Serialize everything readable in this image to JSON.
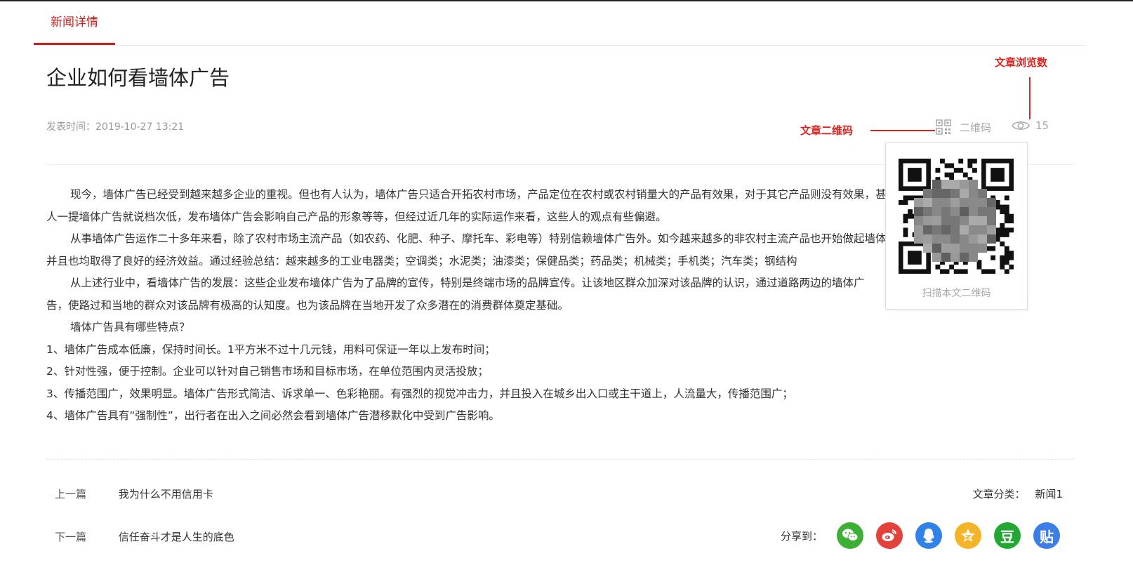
{
  "tab": {
    "label": "新闻详情"
  },
  "article": {
    "title": "企业如何看墙体广告",
    "publish_time": "发表时间：2019-10-27 13:21",
    "qr_label": "二维码",
    "views": "15",
    "paragraphs": [
      "现今，墙体广告已经受到越来越多企业的重视。但也有人认为，墙体广告只适合开拓农村市场，产品定位在农村或农村销量大的产品有效果，对于其它产品则没有效果，甚至有些",
      "人一提墙体广告就说档次低，发布墙体广告会影响自己产品的形象等等，但经过近几年的实际运作来看，这些人的观点有些偏避。",
      "从事墙体广告运作二十多年来看，除了农村市场主流产品（如农药、化肥、种子、摩托车、彩电等）特别信赖墙体广告外。如今越来越多的非农村主流产品也开始做起墙体广告来，",
      "并且也均取得了良好的经济效益。通过经验总结：越来越多的工业电器类；空调类；水泥类；油漆类；保健品类；药品类；机械类；手机类；汽车类；钢结构",
      "从上述行业中，看墙体广告的发展：这些企业发布墙体广告为了品牌的宣传，特别是终端市场的品牌宣传。让该地区群众加深对该品牌的认识，通过道路两边的墙体广",
      "告，使路过和当地的群众对该品牌有极高的认知度。也为该品牌在当地开发了众多潜在的消费群体奠定基础。",
      "墙体广告具有哪些特点？",
      "1、墙体广告成本低廉，保持时间长。1平方米不过十几元钱，用料可保证一年以上发布时间；",
      "2、针对性强，便于控制。企业可以针对自己销售市场和目标市场，在单位范围内灵活投放；",
      "3、传播范围广，效果明显。墙体广告形式简洁、诉求单一、色彩艳丽。有强烈的视觉冲击力，并且投入在城乡出入口或主干道上，人流量大，传播范围广；",
      "4、墙体广告具有“强制性”，出行者在出入之间必然会看到墙体广告潜移默化中受到广告影响。"
    ]
  },
  "annotations": {
    "views_label": "文章浏览数",
    "qr_label": "文章二维码"
  },
  "qr_popup": {
    "caption": "扫描本文二维码"
  },
  "nav": {
    "prev_label": "上一篇",
    "prev_title": "我为什么不用信用卡",
    "next_label": "下一篇",
    "next_title": "信任奋斗才是人生的底色"
  },
  "category": {
    "label": "文章分类：",
    "value": "新闻1"
  },
  "share": {
    "label": "分享到：",
    "icons": [
      {
        "name": "wechat-icon",
        "color": "#3cb034",
        "glyph": ""
      },
      {
        "name": "weibo-icon",
        "color": "#e6403b",
        "glyph": ""
      },
      {
        "name": "qq-icon",
        "color": "#2f82e6",
        "glyph": ""
      },
      {
        "name": "qzone-icon",
        "color": "#f5b428",
        "glyph": ""
      },
      {
        "name": "douban-icon",
        "color": "#22a733",
        "glyph": "豆"
      },
      {
        "name": "tieba-icon",
        "color": "#3c7de8",
        "glyph": "贴"
      }
    ]
  }
}
